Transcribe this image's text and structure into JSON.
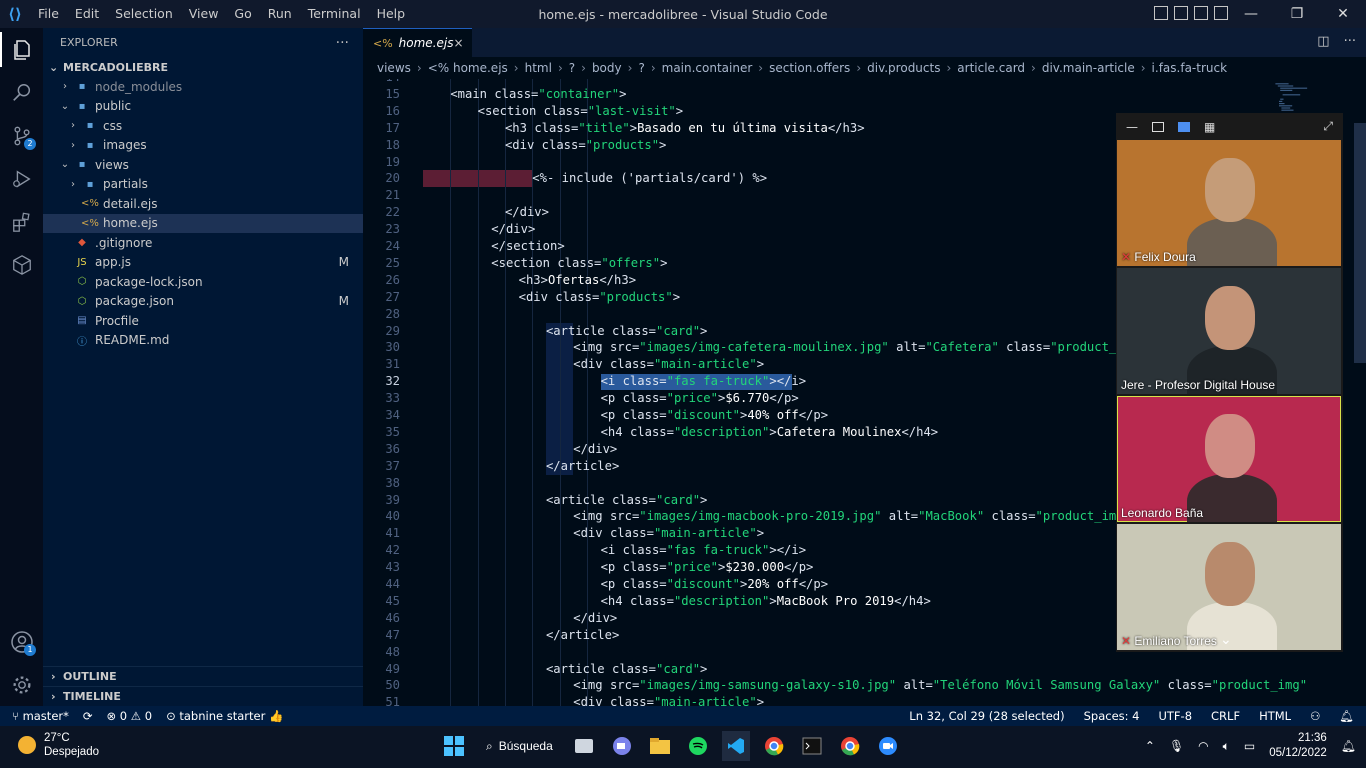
{
  "titlebar": {
    "menu": [
      "File",
      "Edit",
      "Selection",
      "View",
      "Go",
      "Run",
      "Terminal",
      "Help"
    ],
    "title": "home.ejs - mercadolibree - Visual Studio Code"
  },
  "activity": {
    "icons": [
      "explorer-icon",
      "search-icon",
      "source-control-icon",
      "run-debug-icon",
      "extensions-icon",
      "remote-icon",
      "account-icon",
      "settings-icon"
    ],
    "source_control_badge": "2",
    "account_badge": "1"
  },
  "explorer": {
    "header": "EXPLORER",
    "more": "···",
    "root": "MERCADOLIEBRE",
    "items": [
      {
        "label": "node_modules",
        "kind": "folder",
        "level": 1,
        "chevron": "›",
        "dim": true,
        "badge": ""
      },
      {
        "label": "public",
        "kind": "folder",
        "level": 1,
        "chevron": "⌄",
        "dim": false,
        "badge": ""
      },
      {
        "label": "css",
        "kind": "folder",
        "level": 2,
        "chevron": "›",
        "dim": false,
        "badge": ""
      },
      {
        "label": "images",
        "kind": "folder",
        "level": 2,
        "chevron": "›",
        "dim": false,
        "badge": ""
      },
      {
        "label": "views",
        "kind": "folder",
        "level": 1,
        "chevron": "⌄",
        "dim": false,
        "badge": ""
      },
      {
        "label": "partials",
        "kind": "folder",
        "level": 2,
        "chevron": "›",
        "dim": false,
        "badge": ""
      },
      {
        "label": "detail.ejs",
        "kind": "ejs",
        "level": 2,
        "chevron": "",
        "dim": false,
        "badge": ""
      },
      {
        "label": "home.ejs",
        "kind": "ejs",
        "level": 2,
        "chevron": "",
        "dim": false,
        "badge": "",
        "selected": true
      },
      {
        "label": ".gitignore",
        "kind": "git",
        "level": 1,
        "chevron": "",
        "dim": false,
        "badge": ""
      },
      {
        "label": "app.js",
        "kind": "js",
        "level": 1,
        "chevron": "",
        "dim": false,
        "badge": "M"
      },
      {
        "label": "package-lock.json",
        "kind": "json",
        "level": 1,
        "chevron": "",
        "dim": false,
        "badge": ""
      },
      {
        "label": "package.json",
        "kind": "json",
        "level": 1,
        "chevron": "",
        "dim": false,
        "badge": "M"
      },
      {
        "label": "Procfile",
        "kind": "file",
        "level": 1,
        "chevron": "",
        "dim": false,
        "badge": ""
      },
      {
        "label": "README.md",
        "kind": "info",
        "level": 1,
        "chevron": "",
        "dim": false,
        "badge": ""
      }
    ],
    "outline": "OUTLINE",
    "timeline": "TIMELINE"
  },
  "editor": {
    "tab": {
      "icon": "<%",
      "label": "home.ejs",
      "close": "×"
    },
    "breadcrumb": [
      "views",
      "<% home.ejs",
      "html",
      "?",
      "body",
      "?",
      "main.container",
      "section.offers",
      "div.products",
      "article.card",
      "div.main-article",
      "i.fas.fa-truck"
    ],
    "lines": [
      {
        "n": "14",
        "indent": 4,
        "segs": []
      },
      {
        "n": "15",
        "indent": 4,
        "segs": [
          [
            "t",
            "<main "
          ],
          [
            "a",
            "class="
          ],
          [
            "s",
            "\"container\""
          ],
          [
            "t",
            ">"
          ]
        ]
      },
      {
        "n": "16",
        "indent": 8,
        "segs": [
          [
            "t",
            "<section "
          ],
          [
            "a",
            "class="
          ],
          [
            "s",
            "\"last-visit\""
          ],
          [
            "t",
            ">"
          ]
        ]
      },
      {
        "n": "17",
        "indent": 12,
        "segs": [
          [
            "t",
            "<h3 "
          ],
          [
            "a",
            "class="
          ],
          [
            "s",
            "\"title\""
          ],
          [
            "t",
            ">"
          ],
          [
            "x",
            "Basado en tu última visita"
          ],
          [
            "t",
            "</h3>"
          ]
        ]
      },
      {
        "n": "18",
        "indent": 12,
        "segs": [
          [
            "t",
            "<div "
          ],
          [
            "a",
            "class="
          ],
          [
            "s",
            "\"products\""
          ],
          [
            "t",
            ">"
          ]
        ]
      },
      {
        "n": "19",
        "indent": 12,
        "segs": []
      },
      {
        "n": "20",
        "indent": 16,
        "segs": [
          [
            "t",
            "<%- include ('partials/card') %>"
          ]
        ],
        "err": true
      },
      {
        "n": "21",
        "indent": 12,
        "segs": []
      },
      {
        "n": "22",
        "indent": 12,
        "segs": [
          [
            "t",
            "</div>"
          ]
        ]
      },
      {
        "n": "23",
        "indent": 10,
        "segs": [
          [
            "t",
            "</div>"
          ]
        ]
      },
      {
        "n": "24",
        "indent": 10,
        "segs": [
          [
            "t",
            "</section>"
          ]
        ]
      },
      {
        "n": "25",
        "indent": 10,
        "segs": [
          [
            "t",
            "<section "
          ],
          [
            "a",
            "class="
          ],
          [
            "s",
            "\"offers\""
          ],
          [
            "t",
            ">"
          ]
        ]
      },
      {
        "n": "26",
        "indent": 14,
        "segs": [
          [
            "t",
            "<h3>"
          ],
          [
            "x",
            "Ofertas"
          ],
          [
            "t",
            "</h3>"
          ]
        ]
      },
      {
        "n": "27",
        "indent": 14,
        "segs": [
          [
            "t",
            "<div "
          ],
          [
            "a",
            "class="
          ],
          [
            "s",
            "\"products\""
          ],
          [
            "t",
            ">"
          ]
        ]
      },
      {
        "n": "28",
        "indent": 14,
        "segs": []
      },
      {
        "n": "29",
        "indent": 18,
        "segs": [
          [
            "t",
            "<article "
          ],
          [
            "a",
            "class="
          ],
          [
            "s",
            "\"card\""
          ],
          [
            "t",
            ">"
          ]
        ]
      },
      {
        "n": "30",
        "indent": 22,
        "segs": [
          [
            "t",
            "<img "
          ],
          [
            "a",
            "src="
          ],
          [
            "s",
            "\"images/img-cafetera-moulinex.jpg\""
          ],
          [
            "a",
            " alt="
          ],
          [
            "s",
            "\"Cafetera\""
          ],
          [
            "a",
            " class="
          ],
          [
            "s",
            "\"product_img\""
          ]
        ]
      },
      {
        "n": "31",
        "indent": 22,
        "segs": [
          [
            "t",
            "<div "
          ],
          [
            "a",
            "class="
          ],
          [
            "s",
            "\"main-article\""
          ],
          [
            "t",
            ">"
          ]
        ]
      },
      {
        "n": "32",
        "indent": 26,
        "segs": [
          [
            "t",
            "<i "
          ],
          [
            "a",
            "class="
          ],
          [
            "s",
            "\"fas fa-truck\""
          ],
          [
            "t",
            "></i>"
          ]
        ],
        "current": true
      },
      {
        "n": "33",
        "indent": 26,
        "segs": [
          [
            "t",
            "<p "
          ],
          [
            "a",
            "class="
          ],
          [
            "s",
            "\"price\""
          ],
          [
            "t",
            ">"
          ],
          [
            "x",
            "$6.770"
          ],
          [
            "t",
            "</p>"
          ]
        ]
      },
      {
        "n": "34",
        "indent": 26,
        "segs": [
          [
            "t",
            "<p "
          ],
          [
            "a",
            "class="
          ],
          [
            "s",
            "\"discount\""
          ],
          [
            "t",
            ">"
          ],
          [
            "x",
            "40% off"
          ],
          [
            "t",
            "</p>"
          ]
        ]
      },
      {
        "n": "35",
        "indent": 26,
        "segs": [
          [
            "t",
            "<h4 "
          ],
          [
            "a",
            "class="
          ],
          [
            "s",
            "\"description\""
          ],
          [
            "t",
            ">"
          ],
          [
            "x",
            "Cafetera Moulinex"
          ],
          [
            "t",
            "</h4>"
          ]
        ]
      },
      {
        "n": "36",
        "indent": 22,
        "segs": [
          [
            "t",
            "</div>"
          ]
        ]
      },
      {
        "n": "37",
        "indent": 18,
        "segs": [
          [
            "t",
            "</article>"
          ]
        ]
      },
      {
        "n": "38",
        "indent": 18,
        "segs": []
      },
      {
        "n": "39",
        "indent": 18,
        "segs": [
          [
            "t",
            "<article "
          ],
          [
            "a",
            "class="
          ],
          [
            "s",
            "\"card\""
          ],
          [
            "t",
            ">"
          ]
        ]
      },
      {
        "n": "40",
        "indent": 22,
        "segs": [
          [
            "t",
            "<img "
          ],
          [
            "a",
            "src="
          ],
          [
            "s",
            "\"images/img-macbook-pro-2019.jpg\""
          ],
          [
            "a",
            " alt="
          ],
          [
            "s",
            "\"MacBook\""
          ],
          [
            "a",
            " class="
          ],
          [
            "s",
            "\"product_img\""
          ],
          [
            "t",
            ">"
          ]
        ]
      },
      {
        "n": "41",
        "indent": 22,
        "segs": [
          [
            "t",
            "<div "
          ],
          [
            "a",
            "class="
          ],
          [
            "s",
            "\"main-article\""
          ],
          [
            "t",
            ">"
          ]
        ]
      },
      {
        "n": "42",
        "indent": 26,
        "segs": [
          [
            "t",
            "<i "
          ],
          [
            "a",
            "class="
          ],
          [
            "s",
            "\"fas fa-truck\""
          ],
          [
            "t",
            "></i>"
          ]
        ]
      },
      {
        "n": "43",
        "indent": 26,
        "segs": [
          [
            "t",
            "<p "
          ],
          [
            "a",
            "class="
          ],
          [
            "s",
            "\"price\""
          ],
          [
            "t",
            ">"
          ],
          [
            "x",
            "$230.000"
          ],
          [
            "t",
            "</p>"
          ]
        ]
      },
      {
        "n": "44",
        "indent": 26,
        "segs": [
          [
            "t",
            "<p "
          ],
          [
            "a",
            "class="
          ],
          [
            "s",
            "\"discount\""
          ],
          [
            "t",
            ">"
          ],
          [
            "x",
            "20% off"
          ],
          [
            "t",
            "</p>"
          ]
        ]
      },
      {
        "n": "45",
        "indent": 26,
        "segs": [
          [
            "t",
            "<h4 "
          ],
          [
            "a",
            "class="
          ],
          [
            "s",
            "\"description\""
          ],
          [
            "t",
            ">"
          ],
          [
            "x",
            "MacBook Pro 2019"
          ],
          [
            "t",
            "</h4>"
          ]
        ]
      },
      {
        "n": "46",
        "indent": 22,
        "segs": [
          [
            "t",
            "</div>"
          ]
        ]
      },
      {
        "n": "47",
        "indent": 18,
        "segs": [
          [
            "t",
            "</article>"
          ]
        ]
      },
      {
        "n": "48",
        "indent": 18,
        "segs": []
      },
      {
        "n": "49",
        "indent": 18,
        "segs": [
          [
            "t",
            "<article "
          ],
          [
            "a",
            "class="
          ],
          [
            "s",
            "\"card\""
          ],
          [
            "t",
            ">"
          ]
        ]
      },
      {
        "n": "50",
        "indent": 22,
        "segs": [
          [
            "t",
            "<img "
          ],
          [
            "a",
            "src="
          ],
          [
            "s",
            "\"images/img-samsung-galaxy-s10.jpg\""
          ],
          [
            "a",
            " alt="
          ],
          [
            "s",
            "\"Teléfono Móvil Samsung Galaxy\""
          ],
          [
            "a",
            " class="
          ],
          [
            "s",
            "\"product_img\""
          ]
        ]
      },
      {
        "n": "51",
        "indent": 22,
        "segs": [
          [
            "t",
            "<div "
          ],
          [
            "a",
            "class="
          ],
          [
            "s",
            "\"main-article\""
          ],
          [
            "t",
            ">"
          ]
        ]
      }
    ]
  },
  "zoom": {
    "participants": [
      {
        "name": "Felix Doura",
        "muted": true,
        "bg": "#b8742f"
      },
      {
        "name": "Jere - Profesor Digital House",
        "muted": false,
        "bg": "#2b3338"
      },
      {
        "name": "Leonardo Baña",
        "muted": false,
        "bg": "#b8294f",
        "active": true
      },
      {
        "name": "Emiliano Torres",
        "muted": true,
        "bg": "#c9c8b6"
      }
    ]
  },
  "statusbar": {
    "branch": "master*",
    "sync": "⟳",
    "problems": "⊗ 0 ⚠ 0",
    "tabnine": "tabnine starter",
    "cursor": "Ln 32, Col 29 (28 selected)",
    "spaces": "Spaces: 4",
    "encoding": "UTF-8",
    "eol": "CRLF",
    "language": "HTML"
  },
  "taskbar": {
    "temperature": "27°C",
    "weather": "Despejado",
    "search": "Búsqueda",
    "time": "21:36",
    "date": "05/12/2022"
  },
  "colors": {
    "editor_bg": "#000c18",
    "string": "#22d57a",
    "accent": "#1f7bd0"
  }
}
